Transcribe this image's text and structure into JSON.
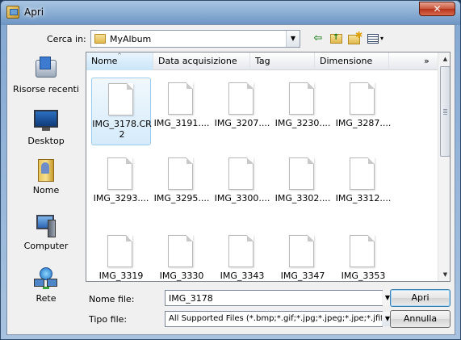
{
  "window": {
    "title": "Apri",
    "close_glyph": "✕",
    "icon": "app-icon"
  },
  "toolbar": {
    "lookin_label": "Cerca in:",
    "lookin_value": "MyAlbum",
    "back_glyph": "⇦",
    "up_glyph": "↑",
    "newfolder_glyph": "✱",
    "views_glyph": "▾",
    "combo_arrow": "▼"
  },
  "places": [
    {
      "label": "Risorse recenti",
      "icon": "recent-places-icon"
    },
    {
      "label": "Desktop",
      "icon": "desktop-icon"
    },
    {
      "label": "Nome",
      "icon": "user-folder-icon"
    },
    {
      "label": "Computer",
      "icon": "computer-icon"
    },
    {
      "label": "Rete",
      "icon": "network-icon"
    }
  ],
  "columns": {
    "name": "Nome",
    "date": "Data acquisizione",
    "tag": "Tag",
    "size": "Dimensione",
    "more": "»",
    "sort_glyph": "^"
  },
  "files": [
    "IMG_3178.CR2",
    "IMG_3191....",
    "IMG_3207....",
    "IMG_3230....",
    "IMG_3287....",
    "IMG_3293....",
    "IMG_3295....",
    "IMG_3300....",
    "IMG_3302....",
    "IMG_3312....",
    "IMG_3319",
    "IMG_3330",
    "IMG_3343",
    "IMG_3347",
    "IMG_3353"
  ],
  "selected_file_index": 0,
  "scrollbar": {
    "up": "▲",
    "down": "▼"
  },
  "bottom": {
    "filename_label": "Nome file:",
    "filename_value": "IMG_3178",
    "filetype_label": "Tipo file:",
    "filetype_value": "All Supported Files (*.bmp;*.gif;*.jpg;*.jpeg;*.jpe;*.jfif;*.",
    "dropdown_arrow": "▼",
    "open_label": "Apri",
    "cancel_label": "Annulla"
  }
}
